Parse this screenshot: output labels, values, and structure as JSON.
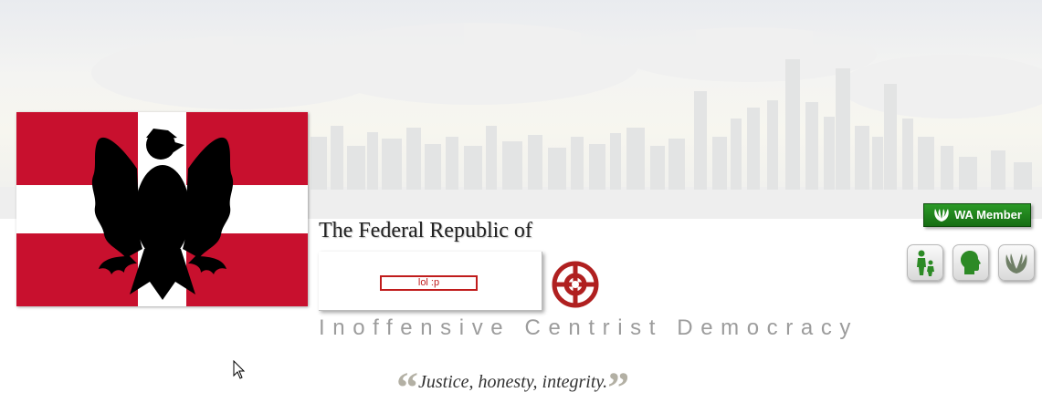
{
  "nation": {
    "pretitle": "The Federal Republic of",
    "name": "lol :p",
    "category": "Inoffensive Centrist Democracy",
    "motto": {
      "open_quote": "“",
      "text": "Justice, honesty, integrity.",
      "close_quote": "”"
    }
  },
  "wa_badge": {
    "label": "WA Member",
    "icon": "laurel-icon",
    "color": "#1e8a1a"
  },
  "flag": {
    "colors": {
      "red": "#c8102e",
      "white": "#ffffff",
      "eagle": "#000000"
    },
    "icon": "eagle-icon"
  },
  "badges": [
    {
      "icon": "family-icon"
    },
    {
      "icon": "head-profile-icon"
    },
    {
      "icon": "laurel-wreath-icon"
    }
  ],
  "category_icon": "crosshair-icon",
  "colors": {
    "category_text": "#9c9c9c",
    "name_border": "#c01c1c",
    "crosshair": "#b02020"
  }
}
